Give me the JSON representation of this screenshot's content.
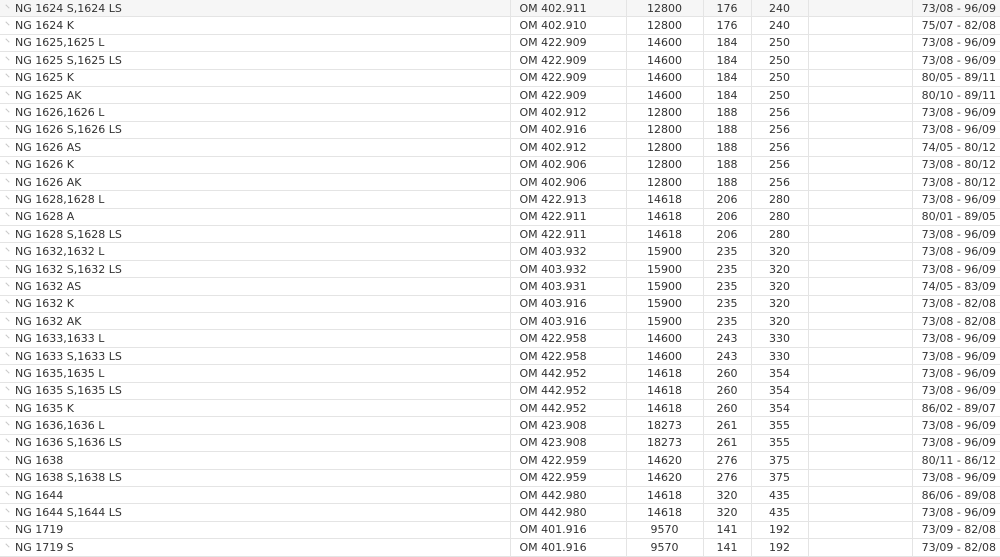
{
  "rows": [
    {
      "name": "NG 1624 S,1624 LS",
      "engine": "OM 402.911",
      "ccm": "12800",
      "kw": "176",
      "ps": "240",
      "years": "73/08 - 96/09"
    },
    {
      "name": "NG 1624 K",
      "engine": "OM 402.910",
      "ccm": "12800",
      "kw": "176",
      "ps": "240",
      "years": "75/07 - 82/08"
    },
    {
      "name": "NG 1625,1625 L",
      "engine": "OM 422.909",
      "ccm": "14600",
      "kw": "184",
      "ps": "250",
      "years": "73/08 - 96/09"
    },
    {
      "name": "NG 1625 S,1625 LS",
      "engine": "OM 422.909",
      "ccm": "14600",
      "kw": "184",
      "ps": "250",
      "years": "73/08 - 96/09"
    },
    {
      "name": "NG 1625 K",
      "engine": "OM 422.909",
      "ccm": "14600",
      "kw": "184",
      "ps": "250",
      "years": "80/05 - 89/11"
    },
    {
      "name": "NG 1625 AK",
      "engine": "OM 422.909",
      "ccm": "14600",
      "kw": "184",
      "ps": "250",
      "years": "80/10 - 89/11"
    },
    {
      "name": "NG 1626,1626 L",
      "engine": "OM 402.912",
      "ccm": "12800",
      "kw": "188",
      "ps": "256",
      "years": "73/08 - 96/09"
    },
    {
      "name": "NG 1626 S,1626 LS",
      "engine": "OM 402.916",
      "ccm": "12800",
      "kw": "188",
      "ps": "256",
      "years": "73/08 - 96/09"
    },
    {
      "name": "NG 1626 AS",
      "engine": "OM 402.912",
      "ccm": "12800",
      "kw": "188",
      "ps": "256",
      "years": "74/05 - 80/12"
    },
    {
      "name": "NG 1626 K",
      "engine": "OM 402.906",
      "ccm": "12800",
      "kw": "188",
      "ps": "256",
      "years": "73/08 - 80/12"
    },
    {
      "name": "NG 1626 AK",
      "engine": "OM 402.906",
      "ccm": "12800",
      "kw": "188",
      "ps": "256",
      "years": "73/08 - 80/12"
    },
    {
      "name": "NG 1628,1628 L",
      "engine": "OM 422.913",
      "ccm": "14618",
      "kw": "206",
      "ps": "280",
      "years": "73/08 - 96/09"
    },
    {
      "name": "NG 1628 A",
      "engine": "OM 422.911",
      "ccm": "14618",
      "kw": "206",
      "ps": "280",
      "years": "80/01 - 89/05"
    },
    {
      "name": "NG 1628 S,1628 LS",
      "engine": "OM 422.911",
      "ccm": "14618",
      "kw": "206",
      "ps": "280",
      "years": "73/08 - 96/09"
    },
    {
      "name": "NG 1632,1632 L",
      "engine": "OM 403.932",
      "ccm": "15900",
      "kw": "235",
      "ps": "320",
      "years": "73/08 - 96/09"
    },
    {
      "name": "NG 1632 S,1632 LS",
      "engine": "OM 403.932",
      "ccm": "15900",
      "kw": "235",
      "ps": "320",
      "years": "73/08 - 96/09"
    },
    {
      "name": "NG 1632 AS",
      "engine": "OM 403.931",
      "ccm": "15900",
      "kw": "235",
      "ps": "320",
      "years": "74/05 - 83/09"
    },
    {
      "name": "NG 1632 K",
      "engine": "OM 403.916",
      "ccm": "15900",
      "kw": "235",
      "ps": "320",
      "years": "73/08 - 82/08"
    },
    {
      "name": "NG 1632 AK",
      "engine": "OM 403.916",
      "ccm": "15900",
      "kw": "235",
      "ps": "320",
      "years": "73/08 - 82/08"
    },
    {
      "name": "NG 1633,1633 L",
      "engine": "OM 422.958",
      "ccm": "14600",
      "kw": "243",
      "ps": "330",
      "years": "73/08 - 96/09"
    },
    {
      "name": "NG 1633 S,1633 LS",
      "engine": "OM 422.958",
      "ccm": "14600",
      "kw": "243",
      "ps": "330",
      "years": "73/08 - 96/09"
    },
    {
      "name": "NG 1635,1635 L",
      "engine": "OM 442.952",
      "ccm": "14618",
      "kw": "260",
      "ps": "354",
      "years": "73/08 - 96/09"
    },
    {
      "name": "NG 1635 S,1635 LS",
      "engine": "OM 442.952",
      "ccm": "14618",
      "kw": "260",
      "ps": "354",
      "years": "73/08 - 96/09"
    },
    {
      "name": "NG 1635 K",
      "engine": "OM 442.952",
      "ccm": "14618",
      "kw": "260",
      "ps": "354",
      "years": "86/02 - 89/07"
    },
    {
      "name": "NG 1636,1636 L",
      "engine": "OM 423.908",
      "ccm": "18273",
      "kw": "261",
      "ps": "355",
      "years": "73/08 - 96/09"
    },
    {
      "name": "NG 1636 S,1636 LS",
      "engine": "OM 423.908",
      "ccm": "18273",
      "kw": "261",
      "ps": "355",
      "years": "73/08 - 96/09"
    },
    {
      "name": "NG 1638",
      "engine": "OM 422.959",
      "ccm": "14620",
      "kw": "276",
      "ps": "375",
      "years": "80/11 - 86/12"
    },
    {
      "name": "NG 1638 S,1638 LS",
      "engine": "OM 422.959",
      "ccm": "14620",
      "kw": "276",
      "ps": "375",
      "years": "73/08 - 96/09"
    },
    {
      "name": "NG 1644",
      "engine": "OM 442.980",
      "ccm": "14618",
      "kw": "320",
      "ps": "435",
      "years": "86/06 - 89/08"
    },
    {
      "name": "NG 1644 S,1644 LS",
      "engine": "OM 442.980",
      "ccm": "14618",
      "kw": "320",
      "ps": "435",
      "years": "73/08 - 96/09"
    },
    {
      "name": "NG 1719",
      "engine": "OM 401.916",
      "ccm": "9570",
      "kw": "141",
      "ps": "192",
      "years": "73/09 - 82/08"
    },
    {
      "name": "NG 1719 S",
      "engine": "OM 401.916",
      "ccm": "9570",
      "kw": "141",
      "ps": "192",
      "years": "73/09 - 82/08"
    }
  ]
}
